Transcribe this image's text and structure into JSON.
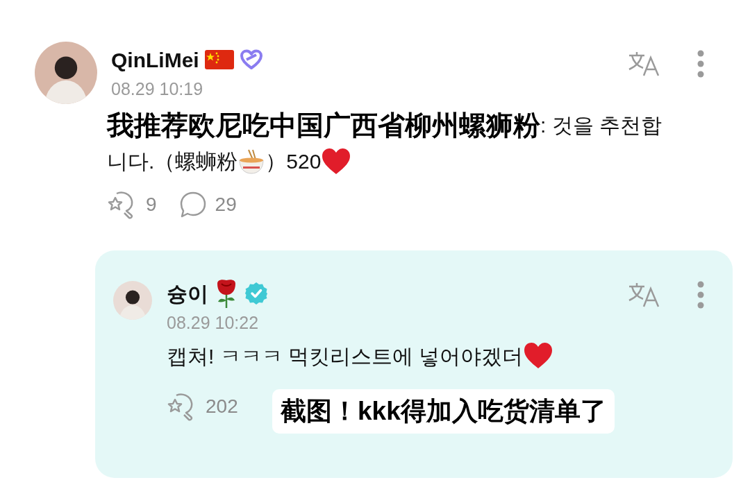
{
  "post": {
    "author": "QinLiMei",
    "date": "08.29 10:19",
    "lines": [
      [
        {
          "kind": "caption",
          "text": "我推荐欧尼吃中国广西省柳州螺狮粉"
        },
        {
          "kind": "text",
          "text": ": 것을 추천합"
        }
      ],
      [
        {
          "kind": "text",
          "text": "니다.（螺蛳粉"
        },
        {
          "kind": "noodles"
        },
        {
          "kind": "text",
          "text": "）520"
        },
        {
          "kind": "heart"
        }
      ]
    ],
    "actions": [
      {
        "kind": "reaction",
        "count": "9"
      },
      {
        "kind": "comment",
        "count": "29"
      }
    ]
  },
  "reply": {
    "author": "슝이",
    "verified": true,
    "date": "08.29 10:22",
    "lines": [
      [
        {
          "kind": "text",
          "text": "캡쳐! ㅋㅋㅋ 먹킷리스트에 넣어야겠더"
        },
        {
          "kind": "heart"
        }
      ]
    ],
    "caption": "截图！kkk得加入吃货清单了",
    "actions": [
      {
        "kind": "reaction",
        "count": "202"
      }
    ]
  }
}
